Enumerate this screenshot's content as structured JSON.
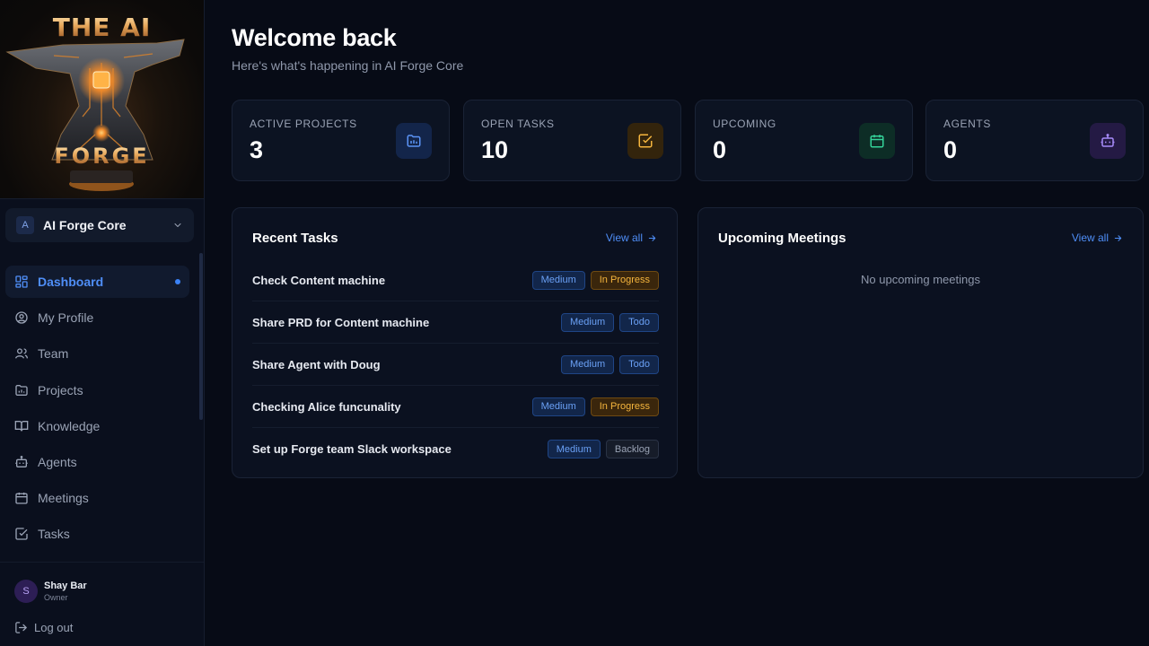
{
  "brand": {
    "logo_top": "THE AI",
    "logo_bottom": "FORGE"
  },
  "workspace": {
    "badge": "A",
    "name": "AI Forge Core"
  },
  "nav": {
    "items": [
      {
        "label": "Dashboard",
        "icon": "dashboard-grid-icon",
        "active": true
      },
      {
        "label": "My Profile",
        "icon": "user-circle-icon"
      },
      {
        "label": "Team",
        "icon": "users-icon"
      },
      {
        "label": "Projects",
        "icon": "folder-icon"
      },
      {
        "label": "Knowledge",
        "icon": "book-open-icon"
      },
      {
        "label": "Agents",
        "icon": "bot-icon"
      },
      {
        "label": "Meetings",
        "icon": "calendar-icon"
      },
      {
        "label": "Tasks",
        "icon": "check-square-icon"
      }
    ]
  },
  "user": {
    "initial": "S",
    "name": "Shay Bar",
    "role": "Owner"
  },
  "logout_label": "Log out",
  "header": {
    "title": "Welcome back",
    "subtitle": "Here's what's happening in AI Forge Core"
  },
  "stats": [
    {
      "label": "ACTIVE PROJECTS",
      "value": "3",
      "icon": "folder-chart-icon",
      "color": "#3b82f6"
    },
    {
      "label": "OPEN TASKS",
      "value": "10",
      "icon": "check-square-icon",
      "color": "#f5b53d"
    },
    {
      "label": "UPCOMING",
      "value": "0",
      "icon": "calendar-icon",
      "color": "#34d399"
    },
    {
      "label": "AGENTS",
      "value": "0",
      "icon": "bot-icon",
      "color": "#a78bfa"
    }
  ],
  "recent_tasks": {
    "title": "Recent Tasks",
    "view_all": "View all",
    "items": [
      {
        "title": "Check Content machine",
        "priority": "Medium",
        "status": "In Progress"
      },
      {
        "title": "Share PRD for Content machine",
        "priority": "Medium",
        "status": "Todo"
      },
      {
        "title": "Share Agent with Doug",
        "priority": "Medium",
        "status": "Todo"
      },
      {
        "title": "Checking Alice funcunality",
        "priority": "Medium",
        "status": "In Progress"
      },
      {
        "title": "Set up Forge team Slack workspace",
        "priority": "Medium",
        "status": "Backlog"
      }
    ]
  },
  "meetings": {
    "title": "Upcoming Meetings",
    "view_all": "View all",
    "empty": "No upcoming meetings"
  },
  "colors": {
    "accent": "#3b82f6",
    "background": "#070b16",
    "in_progress": "#f5b53d",
    "todo": "#6aa0f5"
  }
}
